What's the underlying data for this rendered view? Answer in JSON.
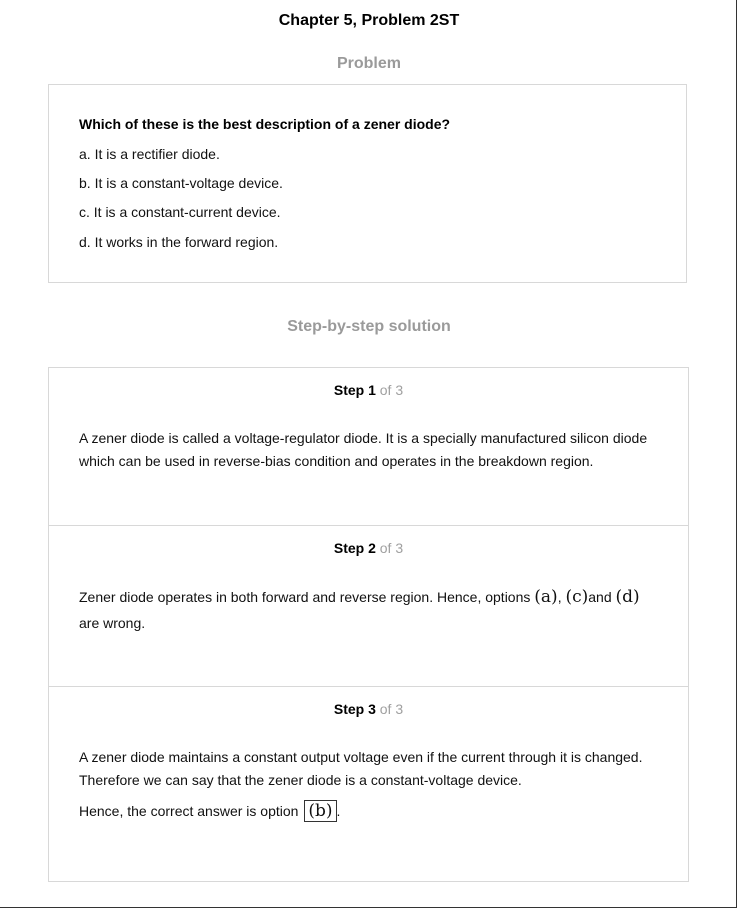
{
  "chapter_title": "Chapter 5, Problem 2ST",
  "problem_heading": "Problem",
  "problem": {
    "question": "Which of these is the best description of a zener diode?",
    "options": [
      "a. It is a rectifier diode.",
      "b. It is a constant-voltage device.",
      "c. It is a constant-current device.",
      "d. It works in the forward region."
    ]
  },
  "solution_heading": "Step-by-step solution",
  "steps": [
    {
      "label": "Step 1",
      "of": "of 3",
      "text": "A zener diode is called a voltage-regulator diode. It is a specially manufactured silicon diode which can be used in reverse-bias condition and operates in the breakdown region."
    },
    {
      "label": "Step 2",
      "of": "of 3",
      "text_before": "Zener diode operates in both forward and reverse region. Hence, options ",
      "opt_a": "(a)",
      "sep1": ", ",
      "opt_c": "(c)",
      "and_word": "and ",
      "opt_d": "(d)",
      "text_after": "are wrong."
    },
    {
      "label": "Step 3",
      "of": "of 3",
      "text": "A zener diode maintains a constant output voltage even if the current through it is changed. Therefore we can say that the zener diode is a constant-voltage device.",
      "answer_prefix": "Hence, the correct answer is option ",
      "answer": "(b)",
      "answer_suffix": "."
    }
  ]
}
